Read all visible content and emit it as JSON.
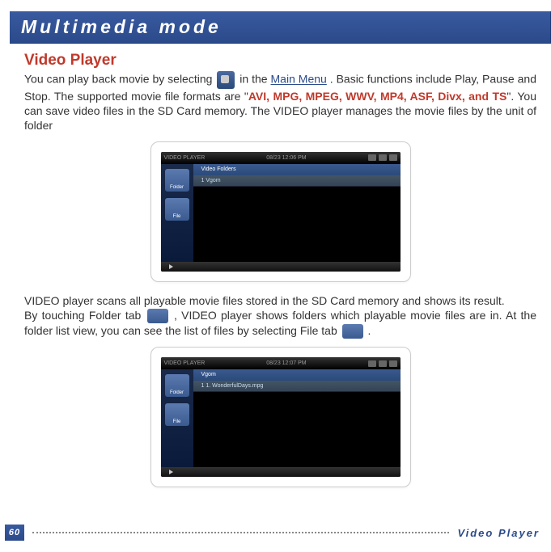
{
  "header": {
    "title": "Multimedia mode"
  },
  "section": {
    "title": "Video Player",
    "p1a": "You can play back movie by selecting ",
    "p1b": " in the ",
    "main_menu": "Main Menu",
    "p1c": ". Basic functions include Play, Pause and Stop. The supported movie file formats are \"",
    "formats": "AVI, MPG, MPEG, WWV, MP4, ASF, Divx, and TS",
    "p1d": "\". You can save video files in the SD Card memory. The VIDEO player manages the movie files by the unit of folder",
    "p2": "VIDEO player scans all playable movie files stored in the SD Card memory and shows its result.",
    "p3a": "By touching Folder tab ",
    "p3b": ", VIDEO player shows folders which playable movie files are in. At the folder list view, you can see the list of files by selecting File tab ",
    "p3c": " ."
  },
  "screenshot1": {
    "title": "VIDEO PLAYER",
    "time": "08/23   12:06 PM",
    "listHeader": "Video Folders",
    "row1": "1 Vgom",
    "tab1": "Folder",
    "tab2": "File"
  },
  "screenshot2": {
    "title": "VIDEO PLAYER",
    "time": "08/23   12:07 PM",
    "listHeader": "Vgom",
    "row1": "1 1. WonderfulDays.mpg",
    "tab1": "Folder",
    "tab2": "File"
  },
  "footer": {
    "page": "60",
    "label": "Video Player"
  }
}
